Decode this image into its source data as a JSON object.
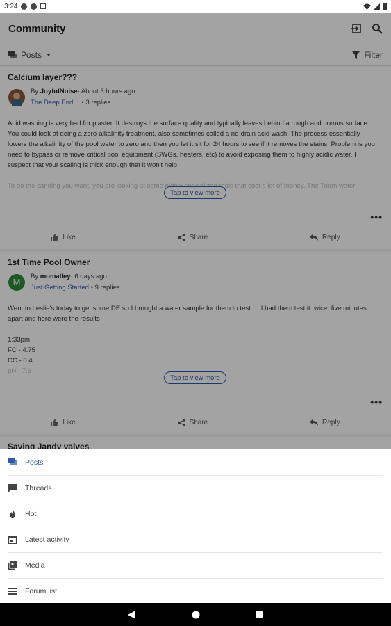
{
  "status_bar": {
    "time": "3:24"
  },
  "app_bar": {
    "title": "Community"
  },
  "toolbar": {
    "posts_label": "Posts",
    "filter_label": "Filter"
  },
  "posts": [
    {
      "title": "Calcium layer???",
      "by_prefix": "By ",
      "author": "JoyfulNoise",
      "time": "· About 3 hours ago",
      "forum": "The Deep End…",
      "replies": "• 3 replies",
      "body": "Acid washing is very bad for plaster. It destroys the surface quality and typically leaves behind a rough and porous surface. You could look at doing a zero-alkalinity treatment, also sometimes called a no-drain acid wash. The process essentially lowers the alkalinity of the pool water to zero and then you let it sit for 24 hours to see if it removes the stains. Problem is you need to bypass or remove critical pool equipment (SWGs, heaters, etc) to avoid exposing them to highly acidic water. I suspect that your scaling is thick enough that it won't help.",
      "body_fade": "To do the sanding you want, you are looking at some highly specialized tools that cost a lot of money. The Triton water",
      "tap_label": "Tap to view more",
      "like": "Like",
      "share": "Share",
      "reply": "Reply"
    },
    {
      "title": "1st Time Pool Owner",
      "by_prefix": "By ",
      "author": "momalley",
      "time": "· 6 days ago",
      "avatar_letter": "M",
      "forum": "Just Getting Started",
      "replies": "• 9 replies",
      "body": "Went to Leslie's today to get some DE so I brought a water sample for them to test…..I had them test it twice, five minutes apart and here were the results",
      "lines": [
        "1:33pm",
        "FC - 4.75",
        "CC - 0.4",
        "pH - 7.6"
      ],
      "tap_label": "Tap to view more",
      "like": "Like",
      "share": "Share",
      "reply": "Reply"
    },
    {
      "title": "Saving Jandy valves"
    }
  ],
  "sheet": {
    "items": [
      {
        "label": "Posts",
        "icon": "posts-icon",
        "active": true
      },
      {
        "label": "Threads",
        "icon": "threads-icon"
      },
      {
        "label": "Hot",
        "icon": "flame-icon"
      },
      {
        "label": "Latest activity",
        "icon": "calendar-icon"
      },
      {
        "label": "Media",
        "icon": "media-icon"
      },
      {
        "label": "Forum list",
        "icon": "list-icon"
      }
    ]
  },
  "colors": {
    "accent": "#2e5aa8",
    "avatar_green": "#2e8b3a"
  }
}
